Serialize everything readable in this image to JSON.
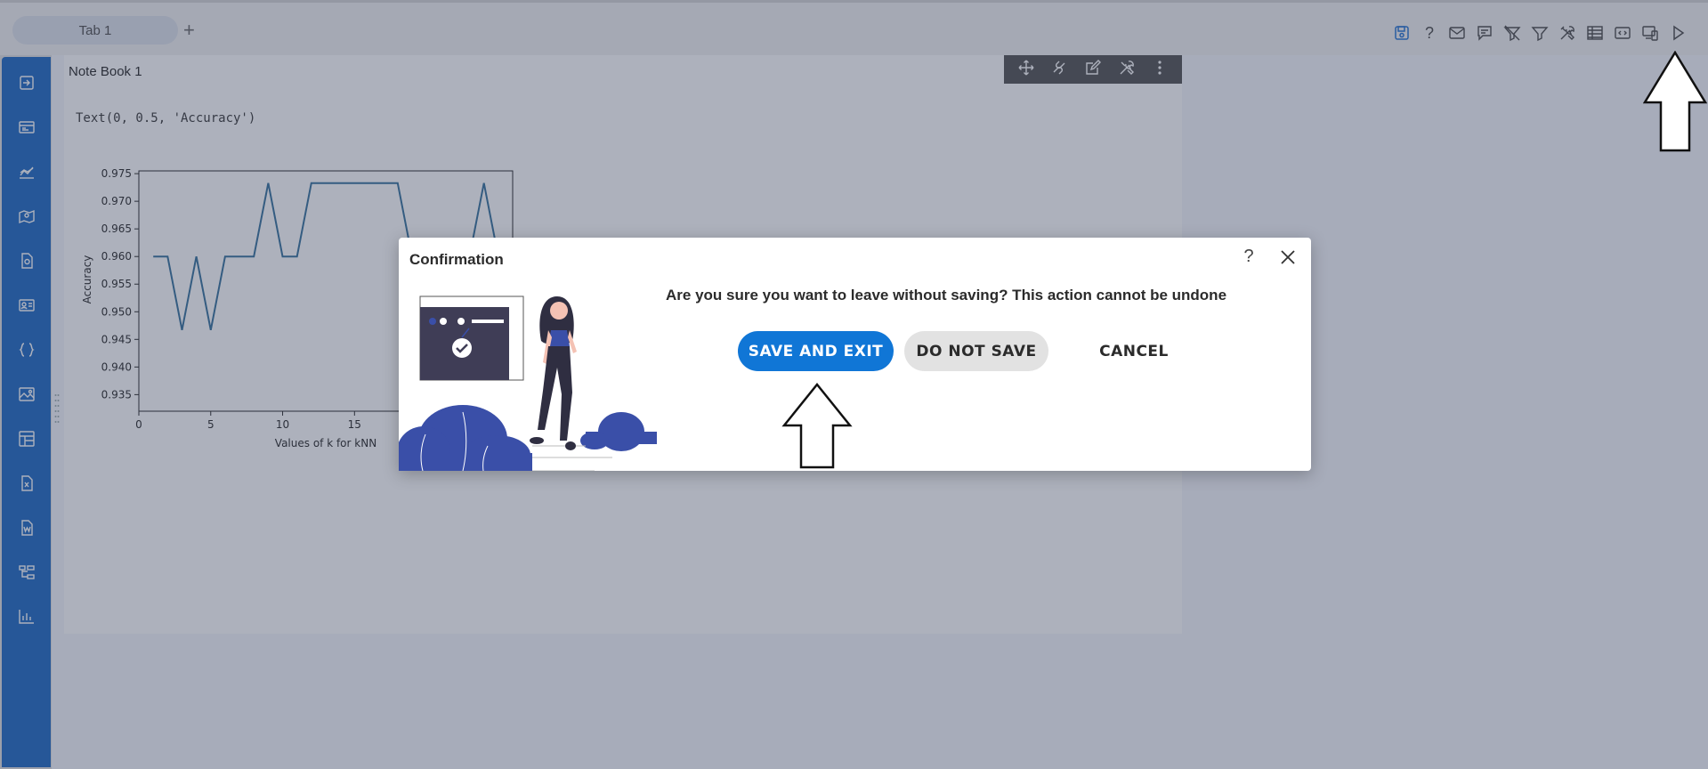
{
  "tabs": [
    {
      "label": "Tab 1"
    }
  ],
  "tab_add_label": "+",
  "toolbar": {
    "icons": [
      "save-icon",
      "help-icon",
      "mail-icon",
      "comment-icon",
      "clear-filter-icon",
      "filter-icon",
      "tools-icon",
      "table-icon",
      "embed-icon",
      "devices-icon",
      "run-icon"
    ],
    "help_glyph": "?"
  },
  "sidebar": {
    "icons": [
      "exit-icon",
      "dataset-icon",
      "chart-icon",
      "map-icon",
      "document-icon",
      "contact-card-icon",
      "code-braces-icon",
      "image-icon",
      "layout-icon",
      "excel-icon",
      "word-icon",
      "hierarchy-icon",
      "bar-chart-icon"
    ]
  },
  "notebook": {
    "title": "Note Book 1",
    "output_text": "Text(0, 0.5, 'Accuracy')",
    "cell_toolbar_icons": [
      "move-icon",
      "link-icon",
      "edit-icon",
      "settings-icon",
      "more-icon"
    ]
  },
  "chart_data": {
    "type": "line",
    "title": "",
    "xlabel": "Values of k for kNN",
    "ylabel": "Accuracy",
    "xlim": [
      0,
      26
    ],
    "ylim": [
      0.932,
      0.9755
    ],
    "x_ticks": [
      "0",
      "5",
      "10",
      "15"
    ],
    "y_ticks": [
      "0.935",
      "0.940",
      "0.945",
      "0.950",
      "0.955",
      "0.960",
      "0.965",
      "0.970",
      "0.975"
    ],
    "x": [
      1,
      2,
      3,
      4,
      5,
      6,
      7,
      8,
      9,
      10,
      11,
      12,
      13,
      14,
      15,
      16,
      17,
      18,
      19,
      20,
      21,
      22,
      23,
      24,
      25
    ],
    "y": [
      0.96,
      0.96,
      0.9467,
      0.96,
      0.9467,
      0.96,
      0.96,
      0.96,
      0.9733,
      0.96,
      0.96,
      0.9733,
      0.9733,
      0.9733,
      0.9733,
      0.9733,
      0.9733,
      0.9733,
      0.96,
      0.9533,
      0.9533,
      0.9533,
      0.96,
      0.9733,
      0.96
    ],
    "color": "#2f6d99"
  },
  "dialog": {
    "title": "Confirmation",
    "help_glyph": "?",
    "message": "Are you sure you want to leave without saving? This action cannot be undone",
    "buttons": {
      "save_exit": "SAVE AND EXIT",
      "do_not_save": "DO NOT SAVE",
      "cancel": "CANCEL"
    }
  },
  "colors": {
    "sidebar": "#1765c2",
    "primary_button": "#1076d6",
    "illustration_blue": "#3a4fa8"
  }
}
